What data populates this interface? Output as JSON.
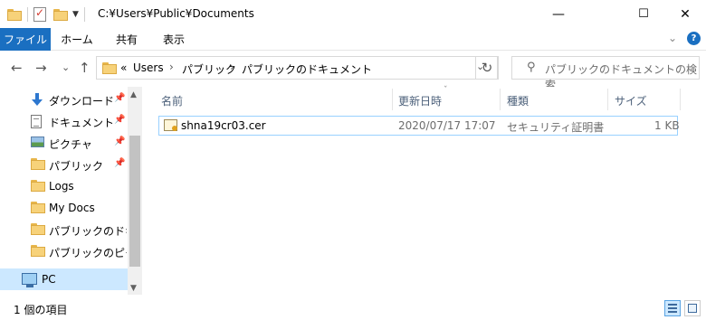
{
  "titlebar": {
    "path": "C:¥Users¥Public¥Documents",
    "minimize_glyph": "—",
    "maximize_glyph": "☐",
    "close_glyph": "✕"
  },
  "ribbon": {
    "tabs": [
      {
        "label": "ファイル"
      },
      {
        "label": "ホーム"
      },
      {
        "label": "共有"
      },
      {
        "label": "表示"
      }
    ],
    "expand_glyph": "⌄",
    "help_glyph": "?"
  },
  "navigation": {
    "back_glyph": "←",
    "forward_glyph": "→",
    "recent_glyph": "⌄",
    "up_glyph": "↑",
    "overflow": "«",
    "breadcrumbs": [
      "Users",
      "パブリック",
      "パブリックのドキュメント"
    ],
    "separator": "›",
    "dropdown_glyph": "⌄",
    "refresh_glyph": "↻"
  },
  "search": {
    "placeholder": "パブリックのドキュメントの検索",
    "icon": "search-icon",
    "icon_glyph": "⚲"
  },
  "sidebar": {
    "items": [
      {
        "label": "ダウンロード",
        "icon": "download-icon",
        "pinned": true
      },
      {
        "label": "ドキュメント",
        "icon": "documents-icon",
        "pinned": true
      },
      {
        "label": "ピクチャ",
        "icon": "pictures-icon",
        "pinned": true
      },
      {
        "label": "パブリック",
        "icon": "folder-icon",
        "pinned": true
      },
      {
        "label": "Logs",
        "icon": "folder-icon",
        "pinned": false
      },
      {
        "label": "My Docs",
        "icon": "folder-icon",
        "pinned": false
      },
      {
        "label": "パブリックのドキュメント",
        "icon": "folder-icon",
        "pinned": false
      },
      {
        "label": "パブリックのピクチャ",
        "icon": "folder-icon",
        "pinned": false
      },
      {
        "label": "PC",
        "icon": "pc-icon",
        "pinned": false,
        "selected": true
      }
    ],
    "pin_glyph": "📌",
    "scroll_up_glyph": "▲",
    "scroll_down_glyph": "▼"
  },
  "filelist": {
    "columns": [
      "名前",
      "更新日時",
      "種類",
      "サイズ"
    ],
    "sort_glyph": "ˇ",
    "rows": [
      {
        "name": "shna19cr03.cer",
        "modified": "2020/07/17 17:07",
        "type": "セキュリティ証明書",
        "size": "1 KB",
        "icon": "certificate-icon"
      }
    ]
  },
  "statusbar": {
    "item_count": "1 個の項目",
    "view_modes": [
      "details-view",
      "large-icons-view"
    ],
    "active_view": "details-view"
  },
  "colors": {
    "accent": "#1a6fc1",
    "selection": "#cce8ff",
    "selection_border": "#99d1ff",
    "folder": "#f7d27a"
  }
}
